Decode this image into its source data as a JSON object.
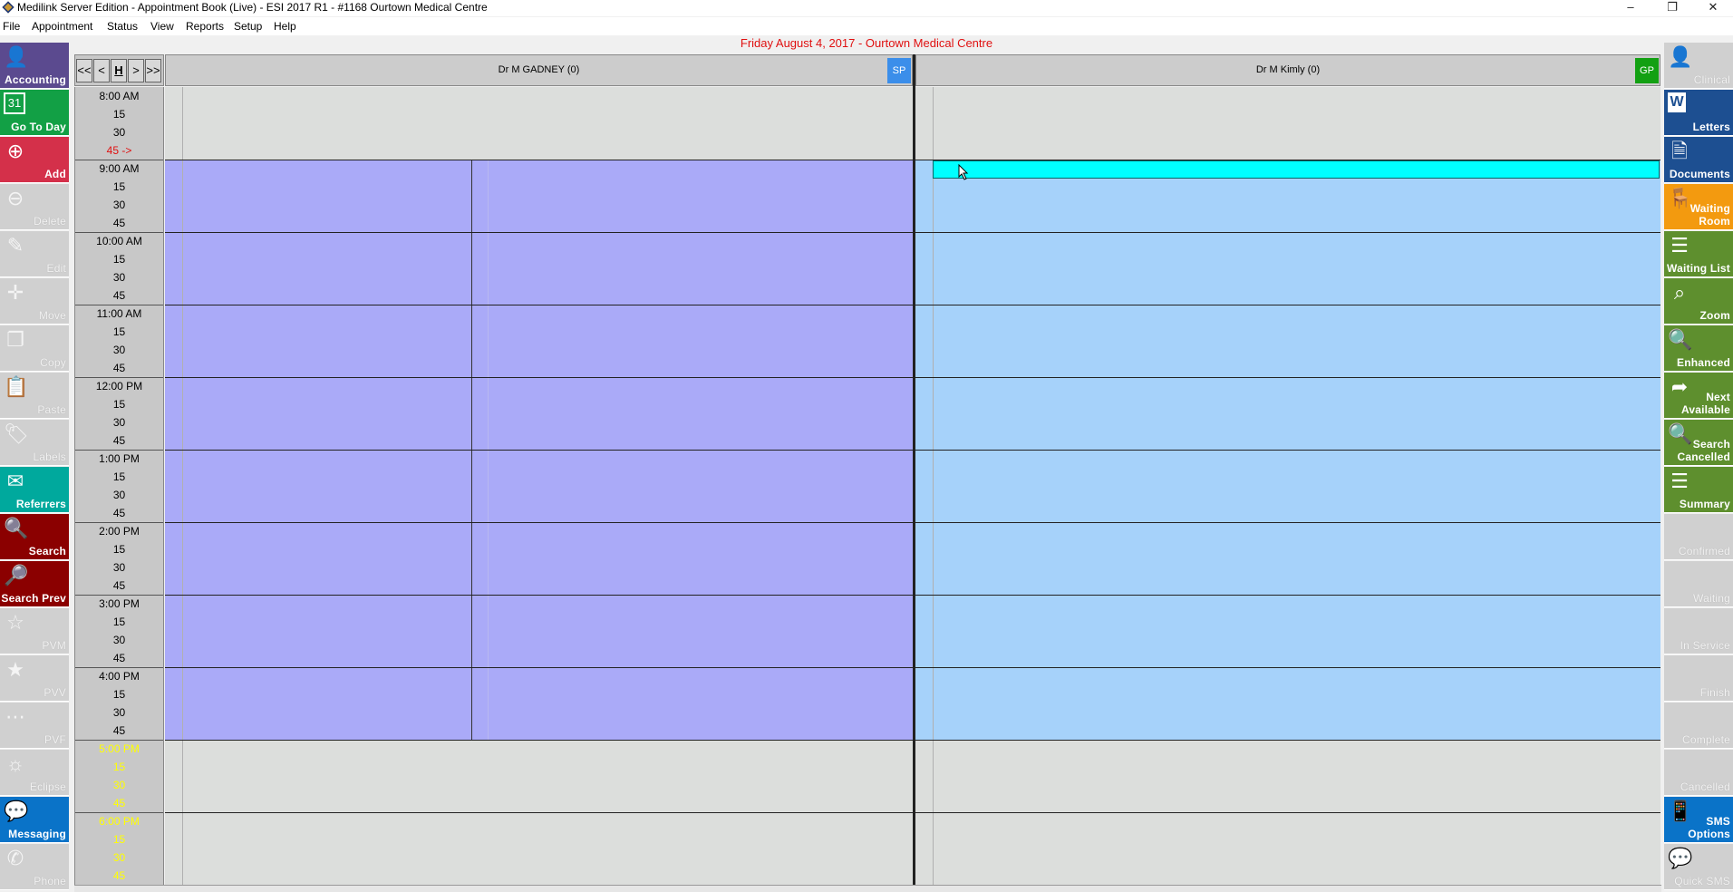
{
  "window": {
    "title": "Medilink Server Edition - Appointment Book (Live) - ESI 2017 R1 - #1168 Ourtown Medical Centre",
    "minimize": "–",
    "restore": "❐",
    "close": "✕"
  },
  "menu": [
    "File",
    "Appointment",
    "Status",
    "View",
    "Reports",
    "Setup",
    "Help"
  ],
  "date_header": "Friday August 4, 2017  -  Ourtown Medical Centre",
  "nav": {
    "first": "<<",
    "prev": "<",
    "home": "H",
    "next": ">",
    "last": ">>"
  },
  "doctors": [
    {
      "name": "Dr M GADNEY (0)",
      "badge": "SP",
      "badge_color": "#3b8eea"
    },
    {
      "name": "Dr M Kimly (0)",
      "badge": "GP",
      "badge_color": "#12a012"
    }
  ],
  "times": [
    {
      "hour": "8:00 AM",
      "q": [
        "15",
        "30",
        "45 ->"
      ],
      "color": "#000000",
      "q3_color": "#e01010"
    },
    {
      "hour": "9:00 AM",
      "q": [
        "15",
        "30",
        "45"
      ],
      "color": "#000000"
    },
    {
      "hour": "10:00 AM",
      "q": [
        "15",
        "30",
        "45"
      ],
      "color": "#000000"
    },
    {
      "hour": "11:00 AM",
      "q": [
        "15",
        "30",
        "45"
      ],
      "color": "#000000"
    },
    {
      "hour": "12:00 PM",
      "q": [
        "15",
        "30",
        "45"
      ],
      "color": "#000000"
    },
    {
      "hour": "1:00 PM",
      "q": [
        "15",
        "30",
        "45"
      ],
      "color": "#000000"
    },
    {
      "hour": "2:00 PM",
      "q": [
        "15",
        "30",
        "45"
      ],
      "color": "#000000"
    },
    {
      "hour": "3:00 PM",
      "q": [
        "15",
        "30",
        "45"
      ],
      "color": "#000000"
    },
    {
      "hour": "4:00 PM",
      "q": [
        "15",
        "30",
        "45"
      ],
      "color": "#000000"
    },
    {
      "hour": "5:00 PM",
      "q": [
        "15",
        "30",
        "45"
      ],
      "color": "#ffff00"
    },
    {
      "hour": "6:00 PM",
      "q": [
        "15",
        "30",
        "45"
      ],
      "color": "#ffff00"
    }
  ],
  "left_toolbar": [
    {
      "label": "Accounting",
      "icon": "person-card-icon",
      "glyph": "👤",
      "color": "#5b4a8f",
      "enabled": true
    },
    {
      "label": "Go To Day",
      "icon": "calendar-icon",
      "glyph": "31",
      "color": "#12a045",
      "enabled": true
    },
    {
      "label": "Add",
      "icon": "plus-circle-icon",
      "glyph": "⊕",
      "color": "#d4304a",
      "enabled": true
    },
    {
      "label": "Delete",
      "icon": "minus-circle-icon",
      "glyph": "⊖",
      "color": "#d0d0d0",
      "enabled": false
    },
    {
      "label": "Edit",
      "icon": "pencil-icon",
      "glyph": "✎",
      "color": "#d0d0d0",
      "enabled": false
    },
    {
      "label": "Move",
      "icon": "move-arrows-icon",
      "glyph": "✛",
      "color": "#d0d0d0",
      "enabled": false
    },
    {
      "label": "Copy",
      "icon": "copy-icon",
      "glyph": "❐",
      "color": "#d0d0d0",
      "enabled": false
    },
    {
      "label": "Paste",
      "icon": "paste-icon",
      "glyph": "📋",
      "color": "#d0d0d0",
      "enabled": false
    },
    {
      "label": "Labels",
      "icon": "tag-icon",
      "glyph": "🏷",
      "color": "#d0d0d0",
      "enabled": false
    },
    {
      "label": "Referrers",
      "icon": "envelope-icon",
      "glyph": "✉",
      "color": "#00a99d",
      "enabled": true
    },
    {
      "label": "Search",
      "icon": "magnifier-icon",
      "glyph": "🔍",
      "color": "#8b0000",
      "enabled": true
    },
    {
      "label": "Search Prev",
      "icon": "search-back-icon",
      "glyph": "🔎",
      "color": "#8b0000",
      "enabled": true
    },
    {
      "label": "PVM",
      "icon": "star-outline-icon",
      "glyph": "☆",
      "color": "#d0d0d0",
      "enabled": false
    },
    {
      "label": "PVV",
      "icon": "medal-icon",
      "glyph": "★",
      "color": "#d0d0d0",
      "enabled": false
    },
    {
      "label": "PVF",
      "icon": "dots-icon",
      "glyph": "⋯",
      "color": "#d0d0d0",
      "enabled": false
    },
    {
      "label": "Eclipse",
      "icon": "sun-icon",
      "glyph": "☼",
      "color": "#d0d0d0",
      "enabled": false
    },
    {
      "label": "Messaging",
      "icon": "chat-bubbles-icon",
      "glyph": "💬",
      "color": "#0a73c8",
      "enabled": true
    },
    {
      "label": "Phone",
      "icon": "phone-icon",
      "glyph": "✆",
      "color": "#d0d0d0",
      "enabled": false
    }
  ],
  "right_toolbar": [
    {
      "label": "Clinical",
      "icon": "doctor-icon",
      "glyph": "👤",
      "color": "#d0d0d0",
      "enabled": false
    },
    {
      "label": "Letters",
      "icon": "word-doc-icon",
      "glyph": "W",
      "color": "#1d4f91",
      "enabled": true
    },
    {
      "label": "Documents",
      "icon": "document-person-icon",
      "glyph": "🗎",
      "color": "#1d4f91",
      "enabled": true
    },
    {
      "label": "Waiting Room",
      "icon": "armchair-icon",
      "glyph": "🪑",
      "color": "#f39a0f",
      "enabled": true
    },
    {
      "label": "Waiting List",
      "icon": "list-icon",
      "glyph": "☰",
      "color": "#5e8f2e",
      "enabled": true
    },
    {
      "label": "Zoom",
      "icon": "binoculars-icon",
      "glyph": "⌕",
      "color": "#5e8f2e",
      "enabled": true
    },
    {
      "label": "Enhanced",
      "icon": "zoom-plus-icon",
      "glyph": "🔍",
      "color": "#5e8f2e",
      "enabled": true
    },
    {
      "label": "Next Available",
      "icon": "forward-arrow-icon",
      "glyph": "➦",
      "color": "#5e8f2e",
      "enabled": true
    },
    {
      "label": "Search Cancelled",
      "icon": "zoom-minus-icon",
      "glyph": "🔍",
      "color": "#5e8f2e",
      "enabled": true
    },
    {
      "label": "Summary",
      "icon": "summary-list-icon",
      "glyph": "☰",
      "color": "#5e8f2e",
      "enabled": true
    },
    {
      "label": "Confirmed",
      "icon": "",
      "glyph": "",
      "color": "#d0d0d0",
      "enabled": false
    },
    {
      "label": "Waiting",
      "icon": "",
      "glyph": "",
      "color": "#d0d0d0",
      "enabled": false
    },
    {
      "label": "In Service",
      "icon": "",
      "glyph": "",
      "color": "#d0d0d0",
      "enabled": false
    },
    {
      "label": "Finish",
      "icon": "",
      "glyph": "",
      "color": "#d0d0d0",
      "enabled": false
    },
    {
      "label": "Complete",
      "icon": "",
      "glyph": "",
      "color": "#d0d0d0",
      "enabled": false
    },
    {
      "label": "Cancelled",
      "icon": "",
      "glyph": "",
      "color": "#d0d0d0",
      "enabled": false
    },
    {
      "label": "SMS Options",
      "icon": "mobile-phone-icon",
      "glyph": "📱",
      "color": "#0a73c8",
      "enabled": true
    },
    {
      "label": "Quick SMS",
      "icon": "chat-icon",
      "glyph": "💬",
      "color": "#d0d0d0",
      "enabled": false
    }
  ],
  "colors": {
    "gadney_session": "#aaaaf8",
    "kimly_session": "#a6d2fa",
    "off_hours": "#dcdedc",
    "selected_appointment": "#00ffff"
  }
}
